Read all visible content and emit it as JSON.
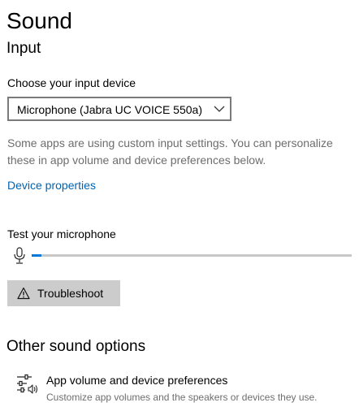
{
  "page": {
    "title": "Sound"
  },
  "input": {
    "section_title": "Input",
    "device_label": "Choose your input device",
    "device_value": "Microphone (Jabra UC VOICE 550a)",
    "description": "Some apps are using custom input settings. You can personalize these in app volume and device preferences below.",
    "device_properties_link": "Device properties",
    "test_label": "Test your microphone",
    "mic_level_percent": 1,
    "troubleshoot_label": "Troubleshoot"
  },
  "other": {
    "section_title": "Other sound options",
    "app_volume_title": "App volume and device preferences",
    "app_volume_subtitle": "Customize app volumes and the speakers or devices they use."
  },
  "colors": {
    "accent": "#0078d7",
    "link": "#0063b1",
    "button_bg": "#cccccc",
    "secondary_text": "#6d6d6d"
  },
  "icons": {
    "chevron": "chevron-down-icon",
    "mic": "microphone-icon",
    "warning": "warning-icon",
    "app_volume": "app-volume-mixer-icon"
  }
}
